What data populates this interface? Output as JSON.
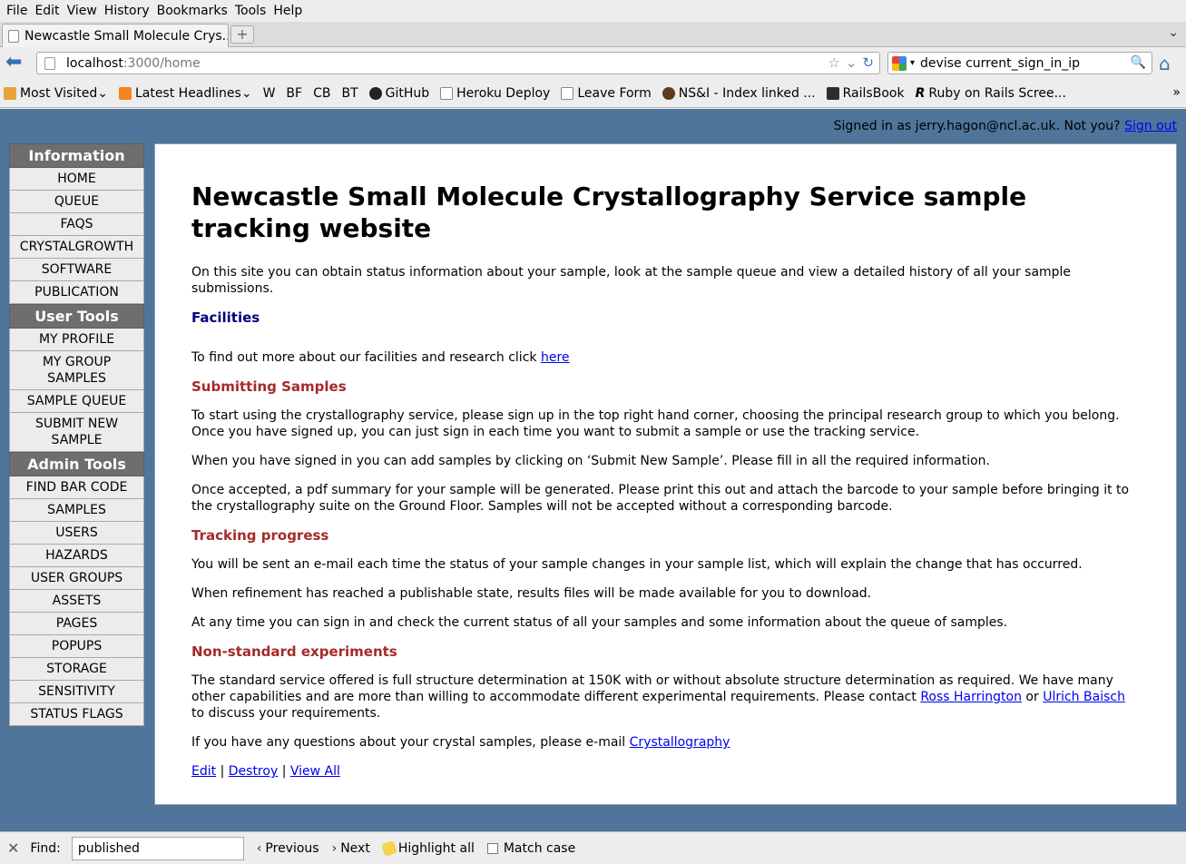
{
  "menubar": {
    "items": [
      "File",
      "Edit",
      "View",
      "History",
      "Bookmarks",
      "Tools",
      "Help"
    ]
  },
  "tabs": {
    "active_title": "Newcastle Small Molecule Crys...",
    "new_tab_label": "+"
  },
  "navigation": {
    "url_host": "localhost",
    "url_path": ":3000/home",
    "search_value": "devise current_sign_in_ip"
  },
  "bookmarks": {
    "most_visited": "Most Visited",
    "latest_headlines": "Latest Headlines",
    "w": "W",
    "bf": "BF",
    "cb": "CB",
    "bt": "BT",
    "github": "GitHub",
    "heroku": "Heroku Deploy",
    "leave_form": "Leave Form",
    "nsi": "NS&I - Index linked ...",
    "railsbook": "RailsBook",
    "ror": "Ruby on Rails Scree..."
  },
  "header": {
    "signed_in_text": "Signed in as jerry.hagon@ncl.ac.uk. Not you?",
    "sign_out": "Sign out"
  },
  "sidebar": {
    "information_heading": "Information",
    "information_items": [
      "HOME",
      "QUEUE",
      "FAQS",
      "CRYSTALGROWTH",
      "SOFTWARE",
      "PUBLICATION"
    ],
    "user_tools_heading": "User Tools",
    "user_tools_items": [
      "MY PROFILE",
      "MY GROUP SAMPLES",
      "SAMPLE QUEUE",
      "SUBMIT NEW SAMPLE"
    ],
    "admin_tools_heading": "Admin Tools",
    "admin_tools_items": [
      "FIND BAR CODE",
      "SAMPLES",
      "USERS",
      "HAZARDS",
      "USER GROUPS",
      "ASSETS",
      "PAGES",
      "POPUPS",
      "STORAGE",
      "SENSITIVITY",
      "STATUS FLAGS"
    ]
  },
  "content": {
    "title": "Newcastle Small Molecule Crystallography Service sample tracking website",
    "intro": "On this site you can obtain status information about your sample, look at the sample queue and view a detailed history of all your sample submissions.",
    "facilities_heading": "Facilities",
    "facilities_text": "To find out more about our facilities and research click",
    "facilities_link": "here",
    "submitting_heading": "Submitting Samples",
    "submitting_p1": "To start using the crystallography service, please sign up in the top right hand corner, choosing the principal research group to which you belong. Once you have signed up, you can just sign in each time you want to submit a sample or use the tracking service.",
    "submitting_p2": "When you have signed in you can add samples by clicking on ‘Submit New Sample’. Please fill in all the required information.",
    "submitting_p3": "Once accepted, a pdf summary for your sample will be generated. Please print this out and attach the barcode to your sample before bringing it to the crystallography suite on the Ground Floor. Samples will not be accepted without a corresponding barcode.",
    "tracking_heading": "Tracking progress",
    "tracking_p1": "You will be sent an e-mail each time the status of your sample changes in your sample list, which will explain the change that has occurred.",
    "tracking_p2": "When refinement has reached a publishable state, results files will be made available for you to download.",
    "tracking_p3": "At any time you can sign in and check the current status of all your samples and some information about the queue of samples.",
    "nonstandard_heading": "Non-standard experiments",
    "nonstandard_text": "The standard service offered is full structure determination at 150K with or without absolute structure determination as required. We have many other capabilities and are more than willing to accommodate different experimental requirements. Please contact",
    "contact1": "Ross Harrington",
    "or_text": "or",
    "contact2": "Ulrich Baisch",
    "nonstandard_tail": "to discuss your requirements.",
    "questions_text": "If you have any questions about your crystal samples, please e-mail",
    "questions_link": "Crystallography",
    "action_edit": "Edit",
    "action_destroy": "Destroy",
    "action_view_all": "View All",
    "separator": "|"
  },
  "findbar": {
    "label": "Find:",
    "value": "published",
    "previous": "Previous",
    "next": "Next",
    "highlight_all": "Highlight all",
    "match_case": "Match case"
  },
  "colors": {
    "page_background": "#4f759a",
    "heading_blue": "#000080",
    "heading_red": "#a52a2a",
    "link": "#0000ee",
    "sidebar_heading": "#6e6e6e"
  }
}
